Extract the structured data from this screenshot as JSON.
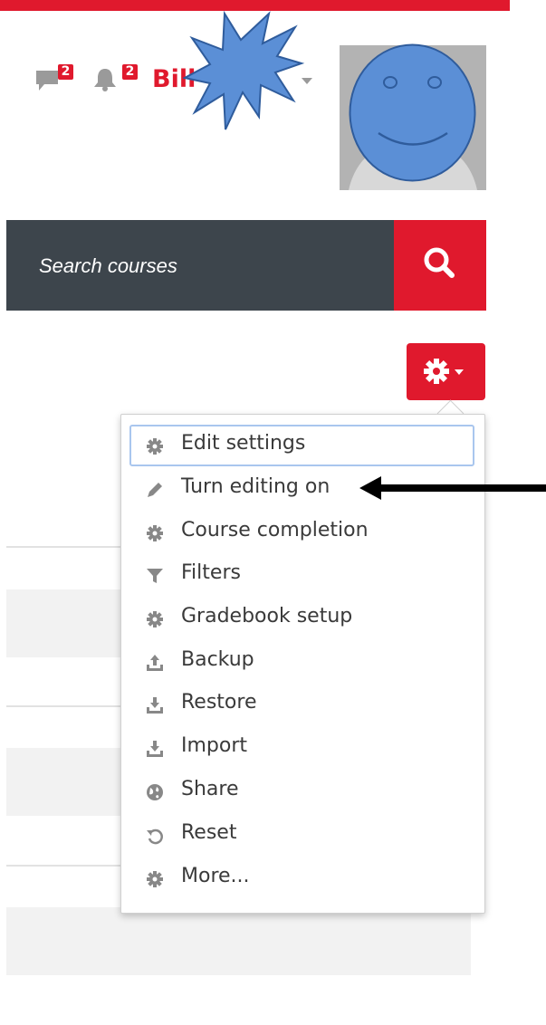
{
  "header": {
    "messages_count": "2",
    "notifications_count": "2",
    "user_name": "Bill"
  },
  "search": {
    "placeholder": "Search courses"
  },
  "menu": {
    "items": [
      {
        "label": "Edit settings",
        "icon": "gear-icon"
      },
      {
        "label": "Turn editing on",
        "icon": "pencil-icon"
      },
      {
        "label": "Course completion",
        "icon": "gear-icon"
      },
      {
        "label": "Filters",
        "icon": "filter-icon"
      },
      {
        "label": "Gradebook setup",
        "icon": "gear-icon"
      },
      {
        "label": "Backup",
        "icon": "upload-icon"
      },
      {
        "label": "Restore",
        "icon": "download-icon"
      },
      {
        "label": "Import",
        "icon": "download-icon"
      },
      {
        "label": "Share",
        "icon": "globe-icon"
      },
      {
        "label": "Reset",
        "icon": "reset-icon"
      },
      {
        "label": "More...",
        "icon": "gear-icon"
      }
    ]
  },
  "colors": {
    "accent": "#e0192d",
    "search_bg": "#3d454c",
    "menu_focus": "#a9c6ee"
  }
}
